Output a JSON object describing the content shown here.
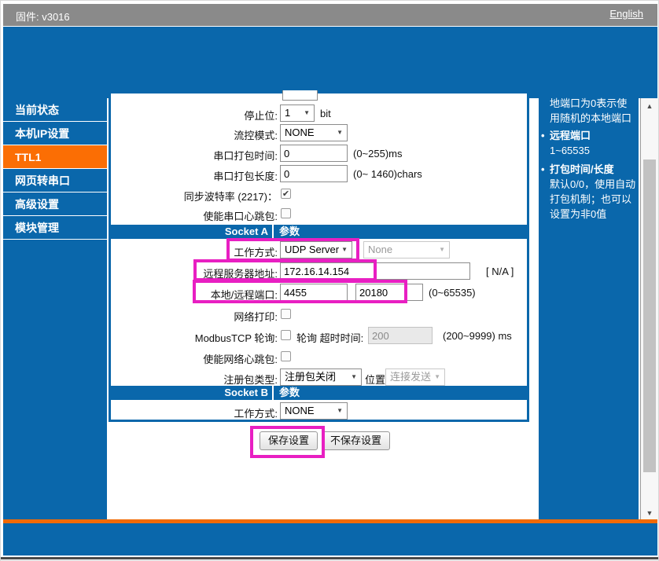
{
  "colors": {
    "blue": "#0a67ab",
    "orange_active": "#fb6e04",
    "orange_bar": "#f26a02",
    "topbar_gray": "#8a8a8a",
    "annotation_magenta": "#e81fc2"
  },
  "titlebar": {
    "firmware": "固件: v3016",
    "language_link": "English"
  },
  "sidebar": {
    "items": [
      {
        "label": "当前状态",
        "active": false
      },
      {
        "label": "本机IP设置",
        "active": false
      },
      {
        "label": "TTL1",
        "active": true
      },
      {
        "label": "网页转串口",
        "active": false
      },
      {
        "label": "高级设置",
        "active": false
      },
      {
        "label": "模块管理",
        "active": false
      }
    ]
  },
  "form": {
    "stop_bits": {
      "label": "停止位:",
      "value": "1",
      "unit": "bit"
    },
    "flow_ctrl": {
      "label": "流控模式:",
      "value": "NONE"
    },
    "pack_time": {
      "label": "串口打包时间:",
      "value": "0",
      "hint": "(0~255)ms"
    },
    "pack_len": {
      "label": "串口打包长度:",
      "value": "0",
      "hint": "(0~ 1460)chars"
    },
    "sync_baud": {
      "label": "同步波特率 (2217)：",
      "checked": "✔"
    },
    "uart_heartbeat": {
      "label": "使能串口心跳包:"
    },
    "socket_a": {
      "left": "Socket A",
      "right": "参数"
    },
    "work_mode_a": {
      "label": "工作方式:",
      "value": "UDP Server",
      "value2": "None"
    },
    "remote_addr": {
      "label": "远程服务器地址:",
      "value": "172.16.14.154",
      "hint": "[ N/A ]"
    },
    "ports": {
      "label": "本地/远程端口:",
      "local": "4455",
      "remote": "20180",
      "hint": "(0~65535)"
    },
    "net_print": {
      "label": "网络打印:"
    },
    "modbus": {
      "label": "ModbusTCP 轮询:",
      "mid_label": "轮询 超时时间:",
      "value": "200",
      "hint": "(200~9999) ms"
    },
    "net_heartbeat": {
      "label": "使能网络心跳包:"
    },
    "reg_pkt": {
      "label": "注册包类型:",
      "value": "注册包关闭",
      "mid_label": "位置",
      "value2": "连接发送"
    },
    "socket_b": {
      "left": "Socket B",
      "right": "参数"
    },
    "work_mode_b": {
      "label": "工作方式:",
      "value": "NONE"
    },
    "buttons": {
      "save": "保存设置",
      "nosave": "不保存设置"
    },
    "select_arrow": "▼"
  },
  "help": {
    "intro": "地端口为0表示使用随机的本地端口",
    "bullet_char": "•",
    "items": [
      {
        "title": "远程端口",
        "body": "1~65535"
      },
      {
        "title": "打包时间/长度",
        "body": "默认0/0，使用自动打包机制；也可以设置为非0值"
      }
    ]
  },
  "scrollbar": {
    "up_arrow": "▲",
    "down_arrow": "▼"
  }
}
